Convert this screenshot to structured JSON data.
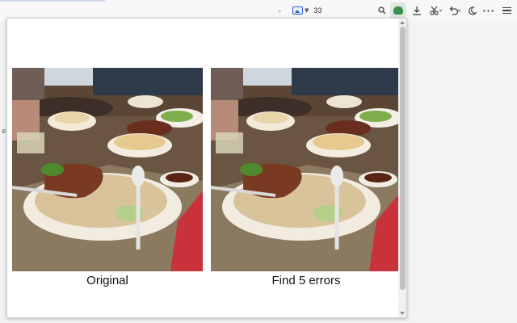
{
  "toolbar": {
    "image_counter": "33",
    "icons": [
      "chevron-down-icon",
      "image-icon",
      "search-icon",
      "puzzle-extension-icon",
      "download-icon",
      "cut-icon",
      "undo-icon",
      "moon-icon",
      "more-icon",
      "menu-icon"
    ],
    "accent_color": "#2a5bd7",
    "extension_color": "#3c8f4e"
  },
  "popup": {
    "left_caption": "Original",
    "right_caption": "Find 5 errors"
  },
  "side_glyph": "e"
}
